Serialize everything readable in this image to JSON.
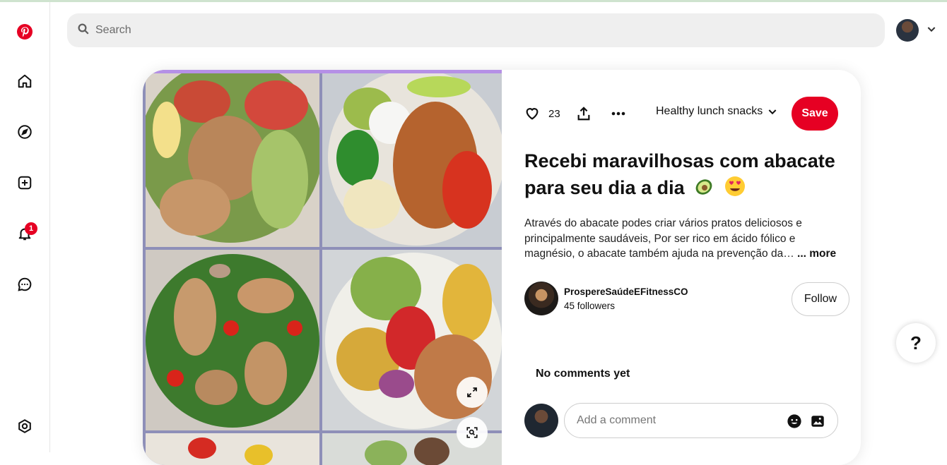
{
  "app": {
    "brand": "Pinterest",
    "brand_color": "#e60023"
  },
  "sidebar": {
    "items": [
      {
        "name": "pinterest-logo-icon"
      },
      {
        "name": "home-icon"
      },
      {
        "name": "explore-compass-icon"
      },
      {
        "name": "create-plus-icon"
      },
      {
        "name": "notifications-bell-icon",
        "badge": "1"
      },
      {
        "name": "messages-chat-icon"
      },
      {
        "name": "settings-gear-icon"
      }
    ]
  },
  "search": {
    "placeholder": "Search"
  },
  "pin": {
    "like_count": "23",
    "board": "Healthy lunch snacks",
    "save_label": "Save",
    "title": "Recebi maravilhosas com abacate para seu dia a dia",
    "title_emojis": [
      "avocado-emoji",
      "heart-eyes-emoji"
    ],
    "description": "Através do abacate podes criar vários pratos deliciosos e principalmente saudáveis, Por ser rico em ácido fólico e magnésio, o abacate também ajuda na prevenção da…",
    "more_label": "... more",
    "creator": {
      "name": "ProspereSaúdeEFitnessCO",
      "followers": "45 followers"
    },
    "follow_label": "Follow",
    "comments_heading": "No comments yet",
    "comment_placeholder": "Add a comment"
  },
  "help": {
    "label": "?"
  }
}
